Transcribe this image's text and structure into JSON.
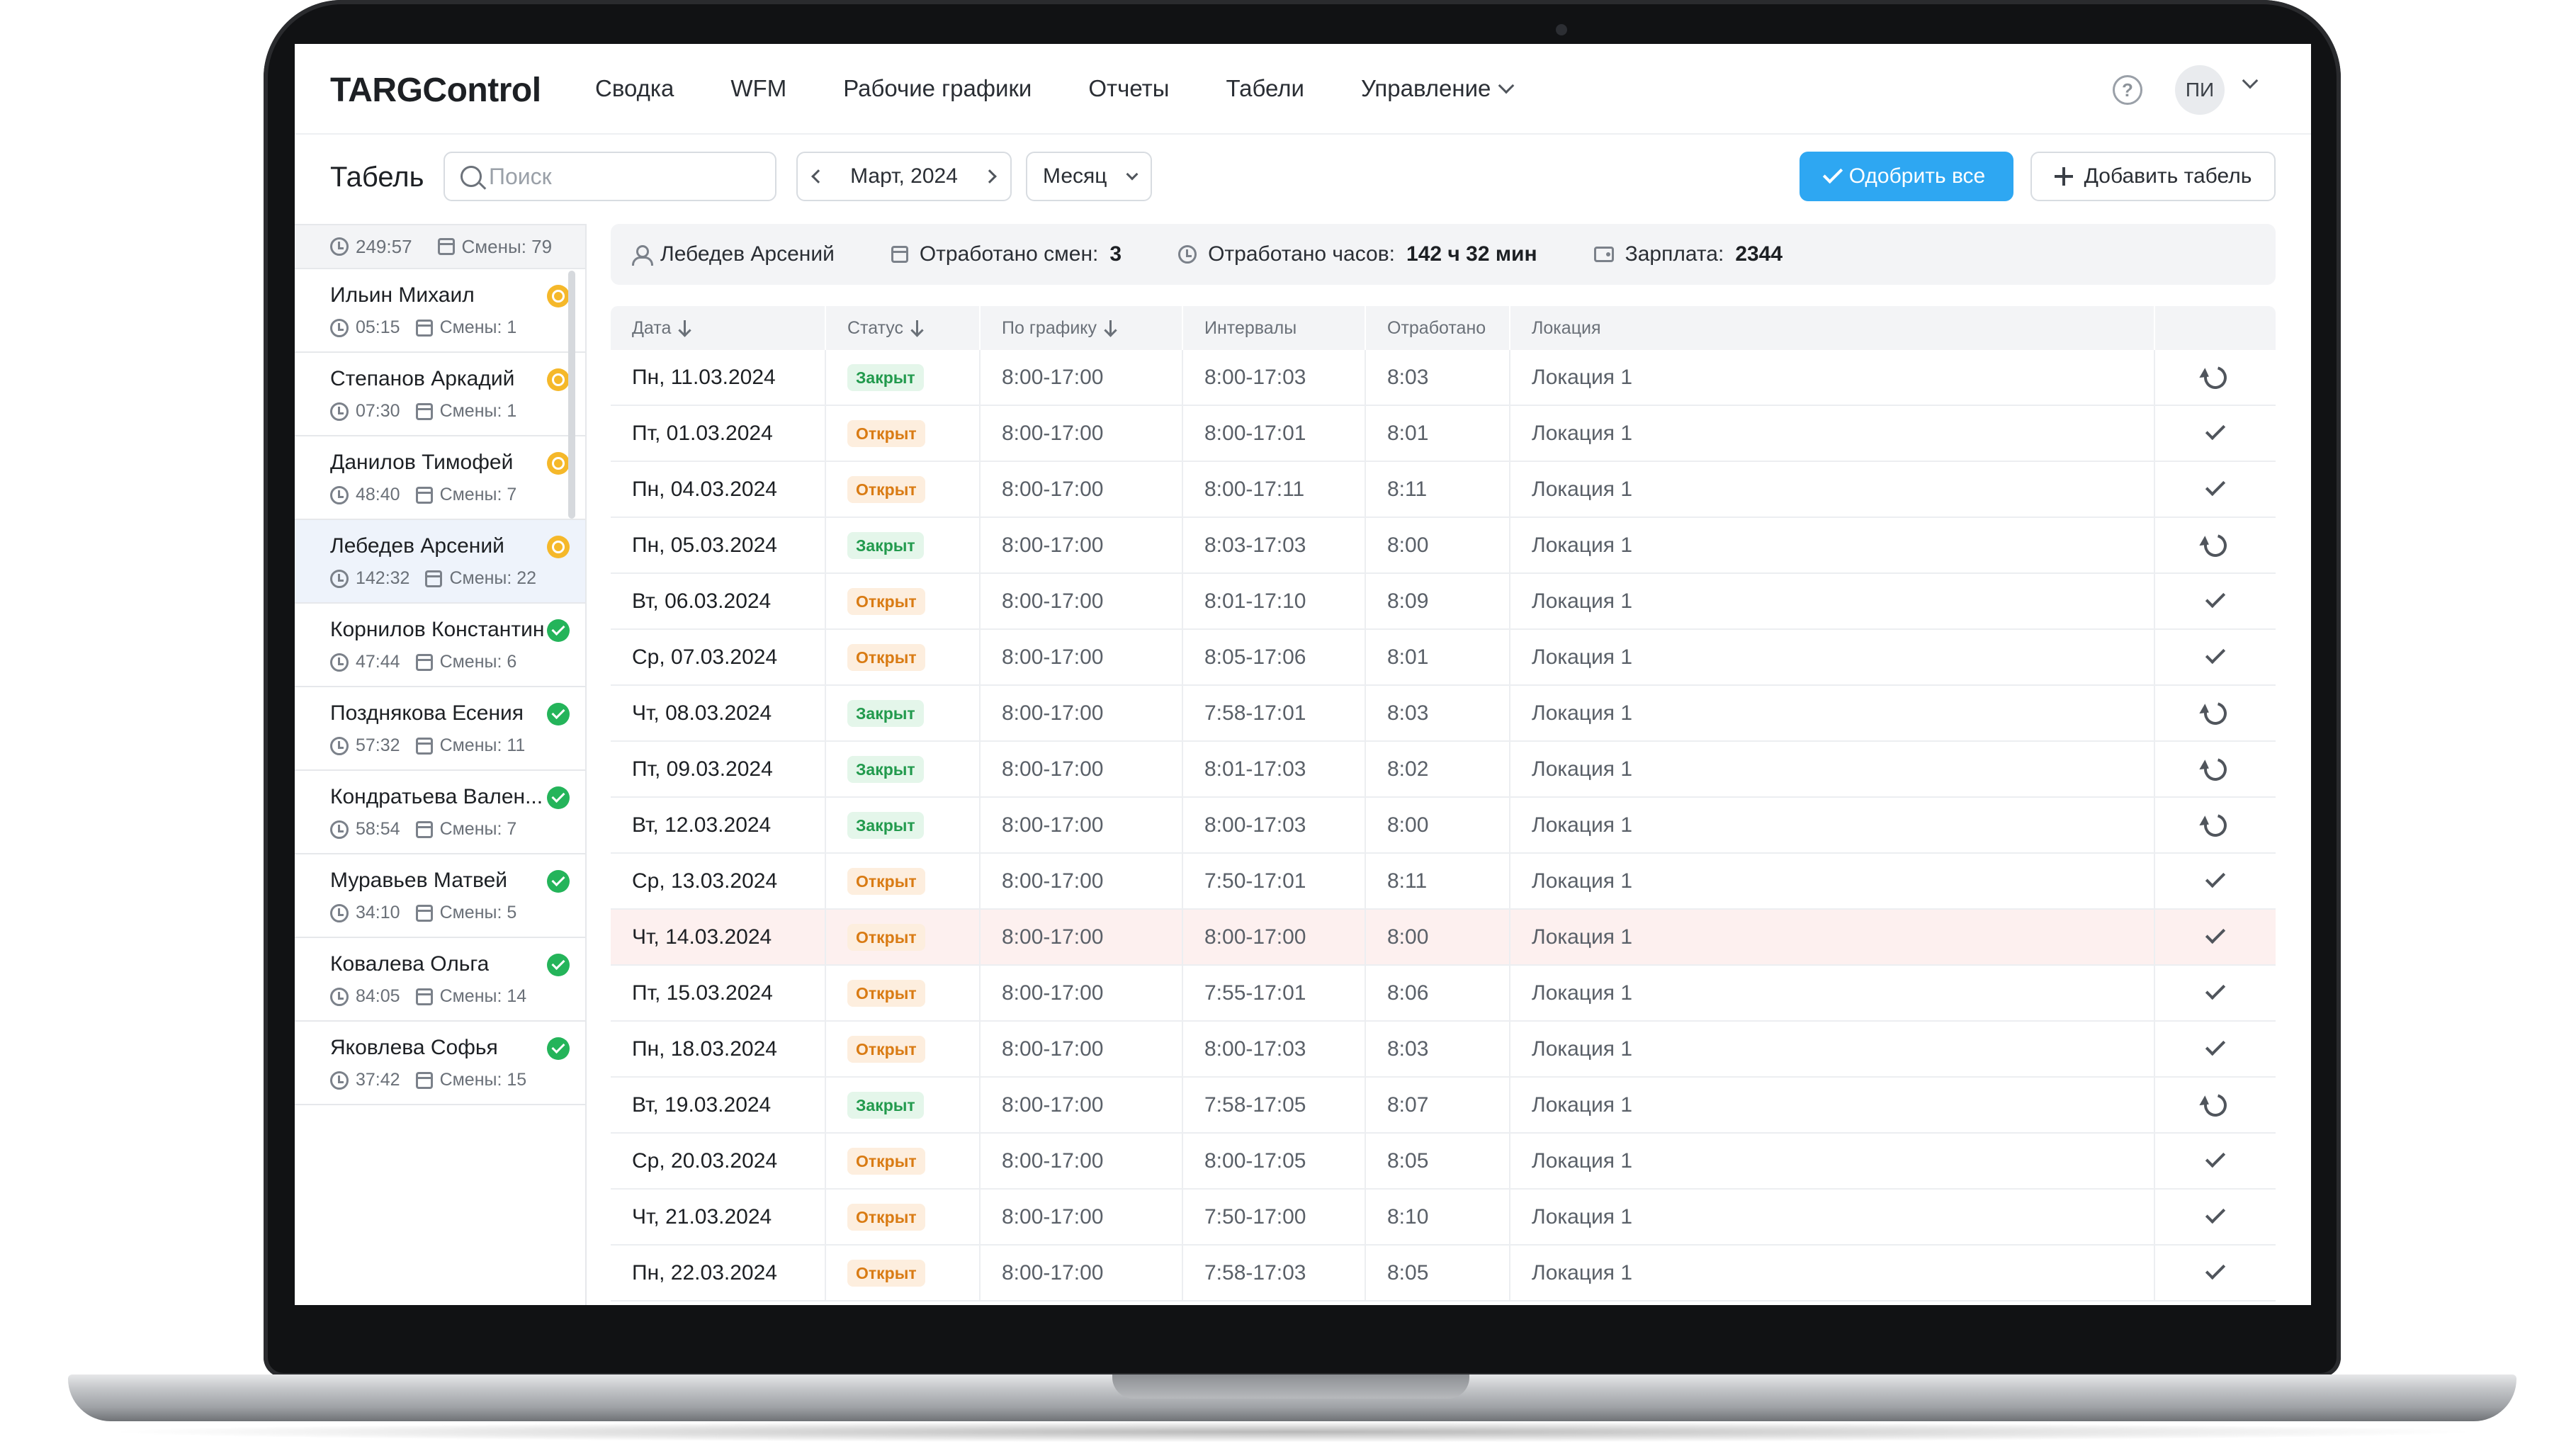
{
  "app": {
    "logo": "TARGControl"
  },
  "nav": {
    "items": [
      "Сводка",
      "WFM",
      "Рабочие графики",
      "Отчеты",
      "Табели",
      "Управление"
    ],
    "help": "?",
    "user_initials": "ПИ"
  },
  "toolbar": {
    "title": "Табель",
    "search_placeholder": "Поиск",
    "month": "Март, 2024",
    "period": "Месяц",
    "approve_all": "Одобрить все",
    "add_timesheet": "Добавить табель"
  },
  "summary": {
    "hours": "249:57",
    "shifts": "Смены: 79"
  },
  "employees": [
    {
      "name": "Ильин Михаил",
      "hours": "05:15",
      "shifts": "Смены: 1",
      "status": "warn"
    },
    {
      "name": "Степанов Аркадий",
      "hours": "07:30",
      "shifts": "Смены: 1",
      "status": "warn"
    },
    {
      "name": "Данилов Тимофей",
      "hours": "48:40",
      "shifts": "Смены: 7",
      "status": "warn"
    },
    {
      "name": "Лебедев Арсений",
      "hours": "142:32",
      "shifts": "Смены: 22",
      "status": "warn",
      "selected": true
    },
    {
      "name": "Корнилов Константин",
      "hours": "47:44",
      "shifts": "Смены: 6",
      "status": "ok"
    },
    {
      "name": "Позднякова Есения",
      "hours": "57:32",
      "shifts": "Смены: 11",
      "status": "ok"
    },
    {
      "name": "Кондратьева Вален...",
      "hours": "58:54",
      "shifts": "Смены: 7",
      "status": "ok"
    },
    {
      "name": "Муравьев Матвей",
      "hours": "34:10",
      "shifts": "Смены: 5",
      "status": "ok"
    },
    {
      "name": "Ковалева Ольга",
      "hours": "84:05",
      "shifts": "Смены: 14",
      "status": "ok"
    },
    {
      "name": "Яковлева Софья",
      "hours": "37:42",
      "shifts": "Смены: 15",
      "status": "ok"
    }
  ],
  "info": {
    "employee": "Лебедев Арсений",
    "shifts_label": "Отработано смен:",
    "shifts_value": "3",
    "hours_label": "Отработано часов:",
    "hours_value": "142 ч 32 мин",
    "salary_label": "Зарплата:",
    "salary_value": "2344"
  },
  "table": {
    "columns": [
      "Дата",
      "Статус",
      "По графику",
      "Интервалы",
      "Отработано",
      "Локация"
    ],
    "rows": [
      {
        "date": "Пн, 11.03.2024",
        "status": "Закрыт",
        "kind": "closed",
        "schedule": "8:00-17:00",
        "intervals": "8:00-17:03",
        "worked": "8:03",
        "location": "Локация 1",
        "action": "undo"
      },
      {
        "date": "Пт, 01.03.2024",
        "status": "Открыт",
        "kind": "open",
        "schedule": "8:00-17:00",
        "intervals": "8:00-17:01",
        "worked": "8:01",
        "location": "Локация 1",
        "action": "check"
      },
      {
        "date": "Пн, 04.03.2024",
        "status": "Открыт",
        "kind": "open",
        "schedule": "8:00-17:00",
        "intervals": "8:00-17:11",
        "worked": "8:11",
        "location": "Локация 1",
        "action": "check"
      },
      {
        "date": "Пн, 05.03.2024",
        "status": "Закрыт",
        "kind": "closed",
        "schedule": "8:00-17:00",
        "intervals": "8:03-17:03",
        "worked": "8:00",
        "location": "Локация 1",
        "action": "undo"
      },
      {
        "date": "Вт, 06.03.2024",
        "status": "Открыт",
        "kind": "open",
        "schedule": "8:00-17:00",
        "intervals": "8:01-17:10",
        "worked": "8:09",
        "location": "Локация 1",
        "action": "check"
      },
      {
        "date": "Ср, 07.03.2024",
        "status": "Открыт",
        "kind": "open",
        "schedule": "8:00-17:00",
        "intervals": "8:05-17:06",
        "worked": "8:01",
        "location": "Локация 1",
        "action": "check"
      },
      {
        "date": "Чт, 08.03.2024",
        "status": "Закрыт",
        "kind": "closed",
        "schedule": "8:00-17:00",
        "intervals": "7:58-17:01",
        "worked": "8:03",
        "location": "Локация 1",
        "action": "undo"
      },
      {
        "date": "Пт, 09.03.2024",
        "status": "Закрыт",
        "kind": "closed",
        "schedule": "8:00-17:00",
        "intervals": "8:01-17:03",
        "worked": "8:02",
        "location": "Локация 1",
        "action": "undo"
      },
      {
        "date": "Вт, 12.03.2024",
        "status": "Закрыт",
        "kind": "closed",
        "schedule": "8:00-17:00",
        "intervals": "8:00-17:03",
        "worked": "8:00",
        "location": "Локация 1",
        "action": "undo"
      },
      {
        "date": "Ср, 13.03.2024",
        "status": "Открыт",
        "kind": "open",
        "schedule": "8:00-17:00",
        "intervals": "7:50-17:01",
        "worked": "8:11",
        "location": "Локация 1",
        "action": "check"
      },
      {
        "date": "Чт, 14.03.2024",
        "status": "Открыт",
        "kind": "open",
        "schedule": "8:00-17:00",
        "intervals": "8:00-17:00",
        "worked": "8:00",
        "location": "Локация 1",
        "action": "check",
        "highlight": true
      },
      {
        "date": "Пт, 15.03.2024",
        "status": "Открыт",
        "kind": "open",
        "schedule": "8:00-17:00",
        "intervals": "7:55-17:01",
        "worked": "8:06",
        "location": "Локация 1",
        "action": "check"
      },
      {
        "date": "Пн, 18.03.2024",
        "status": "Открыт",
        "kind": "open",
        "schedule": "8:00-17:00",
        "intervals": "8:00-17:03",
        "worked": "8:03",
        "location": "Локация 1",
        "action": "check"
      },
      {
        "date": "Вт, 19.03.2024",
        "status": "Закрыт",
        "kind": "closed",
        "schedule": "8:00-17:00",
        "intervals": "7:58-17:05",
        "worked": "8:07",
        "location": "Локация 1",
        "action": "undo"
      },
      {
        "date": "Ср, 20.03.2024",
        "status": "Открыт",
        "kind": "open",
        "schedule": "8:00-17:00",
        "intervals": "8:00-17:05",
        "worked": "8:05",
        "location": "Локация 1",
        "action": "check"
      },
      {
        "date": "Чт, 21.03.2024",
        "status": "Открыт",
        "kind": "open",
        "schedule": "8:00-17:00",
        "intervals": "7:50-17:00",
        "worked": "8:10",
        "location": "Локация 1",
        "action": "check"
      },
      {
        "date": "Пн, 22.03.2024",
        "status": "Открыт",
        "kind": "open",
        "schedule": "8:00-17:00",
        "intervals": "7:58-17:03",
        "worked": "8:05",
        "location": "Локация 1",
        "action": "check"
      }
    ]
  }
}
